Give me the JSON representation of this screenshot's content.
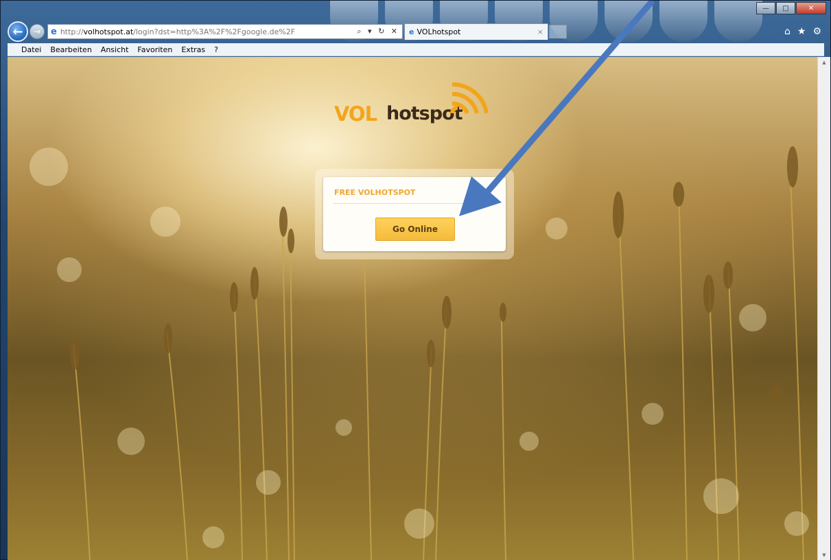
{
  "browser": {
    "address": {
      "scheme": "http://",
      "host": "volhotspot.at",
      "path": "/login?dst=http%3A%2F%2Fgoogle.de%2F",
      "tools": "⌕ ▾ ↻ ✕"
    },
    "tab": {
      "title": "VOLhotspot",
      "close": "×"
    },
    "window_controls": {
      "minimize": "—",
      "maximize": "□",
      "close": "✕"
    },
    "icons": {
      "home": "⌂",
      "favorites": "★",
      "settings": "⚙"
    },
    "menu": [
      "Datei",
      "Bearbeiten",
      "Ansicht",
      "Favoriten",
      "Extras",
      "?"
    ]
  },
  "page": {
    "logo": {
      "part1": "VOL",
      "part2": "hotspot"
    },
    "card": {
      "title": "FREE VOLHOTSPOT",
      "button": "Go Online"
    }
  },
  "colors": {
    "brand_orange": "#f2a51b",
    "arrow_blue": "#4a78bf"
  }
}
